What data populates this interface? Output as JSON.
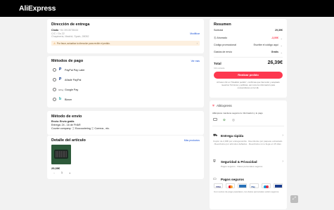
{
  "header": {
    "logo": "AliExpress"
  },
  "address": {
    "title": "Dirección de entrega",
    "name": "Clodo",
    "phone": "+34 3913078444",
    "line1": "C/C / Gs 22",
    "line2": "Chapineria, Madrid, Spain, 28052",
    "change": "Modificar",
    "notice": "Por favor, actualiza tu dirección para recibir el pedido."
  },
  "payment": {
    "title": "Métodos de pago",
    "view_all": "Ver más",
    "methods": [
      {
        "label": "PayPal Pay Later",
        "icon": "paypal-icon"
      },
      {
        "label": "Añadir PayPal",
        "icon": "paypal-icon"
      },
      {
        "label": "Google Pay",
        "icon": "google-pay-icon"
      },
      {
        "label": "Bizum",
        "icon": "bizum-icon"
      }
    ]
  },
  "shipping": {
    "title": "Método de envío",
    "line1": "Envío: Envío gratis",
    "line2": "Entrega: 24 - 16 de FHAR",
    "line3": "Courier company: ⓘ Ecocouriering ⓘ Correos , etc."
  },
  "items": {
    "title": "Detalle del artículo",
    "more": "Más productos",
    "price": "29,39€",
    "qty": "1",
    "minus": "−",
    "plus": "+"
  },
  "summary": {
    "title": "Resumen",
    "rows": [
      {
        "label": "Subtotal",
        "value": "29,39€"
      },
      {
        "label": "Ⓢ Ahorrado",
        "value": "-3,00€"
      },
      {
        "label": "Código promocional",
        "value": "Escribe el código aquí"
      },
      {
        "label": "Gastos de envío",
        "value": "Gratis"
      }
    ],
    "total_label": "Total",
    "total_value": "26,39€",
    "taxes": "IVA incluido",
    "place_order": "Realizar pedido",
    "legal": "Al hacer clic en \"Realizar pedido\", confirmas que has leído y aceptado nuestros Términos y políticas, así como la información para consumidores en la UE."
  },
  "trust": {
    "brand": "AliExpress",
    "text": "AliExpress mantiene seguros tu información y tu pago",
    "fast_title": "Entrega rápida",
    "fast_text": "Cupón de 2,00€ por entrega tardía · Reembolso por paquete extraviado · Reembolso por artículos dañados · Reembolso si no llega en 15 días",
    "security_title": "Seguridad & Privacidad",
    "security_text": "Pagos seguros · Datos personales seguros",
    "pay_title": "Pagos seguros",
    "pay_text": "Con socios de pago populares, tus datos personales están seguros."
  },
  "colors": {
    "accent": "#fd384f",
    "top": "#000000",
    "link": "#1a53d6",
    "warn_bg": "#fdf0df"
  }
}
